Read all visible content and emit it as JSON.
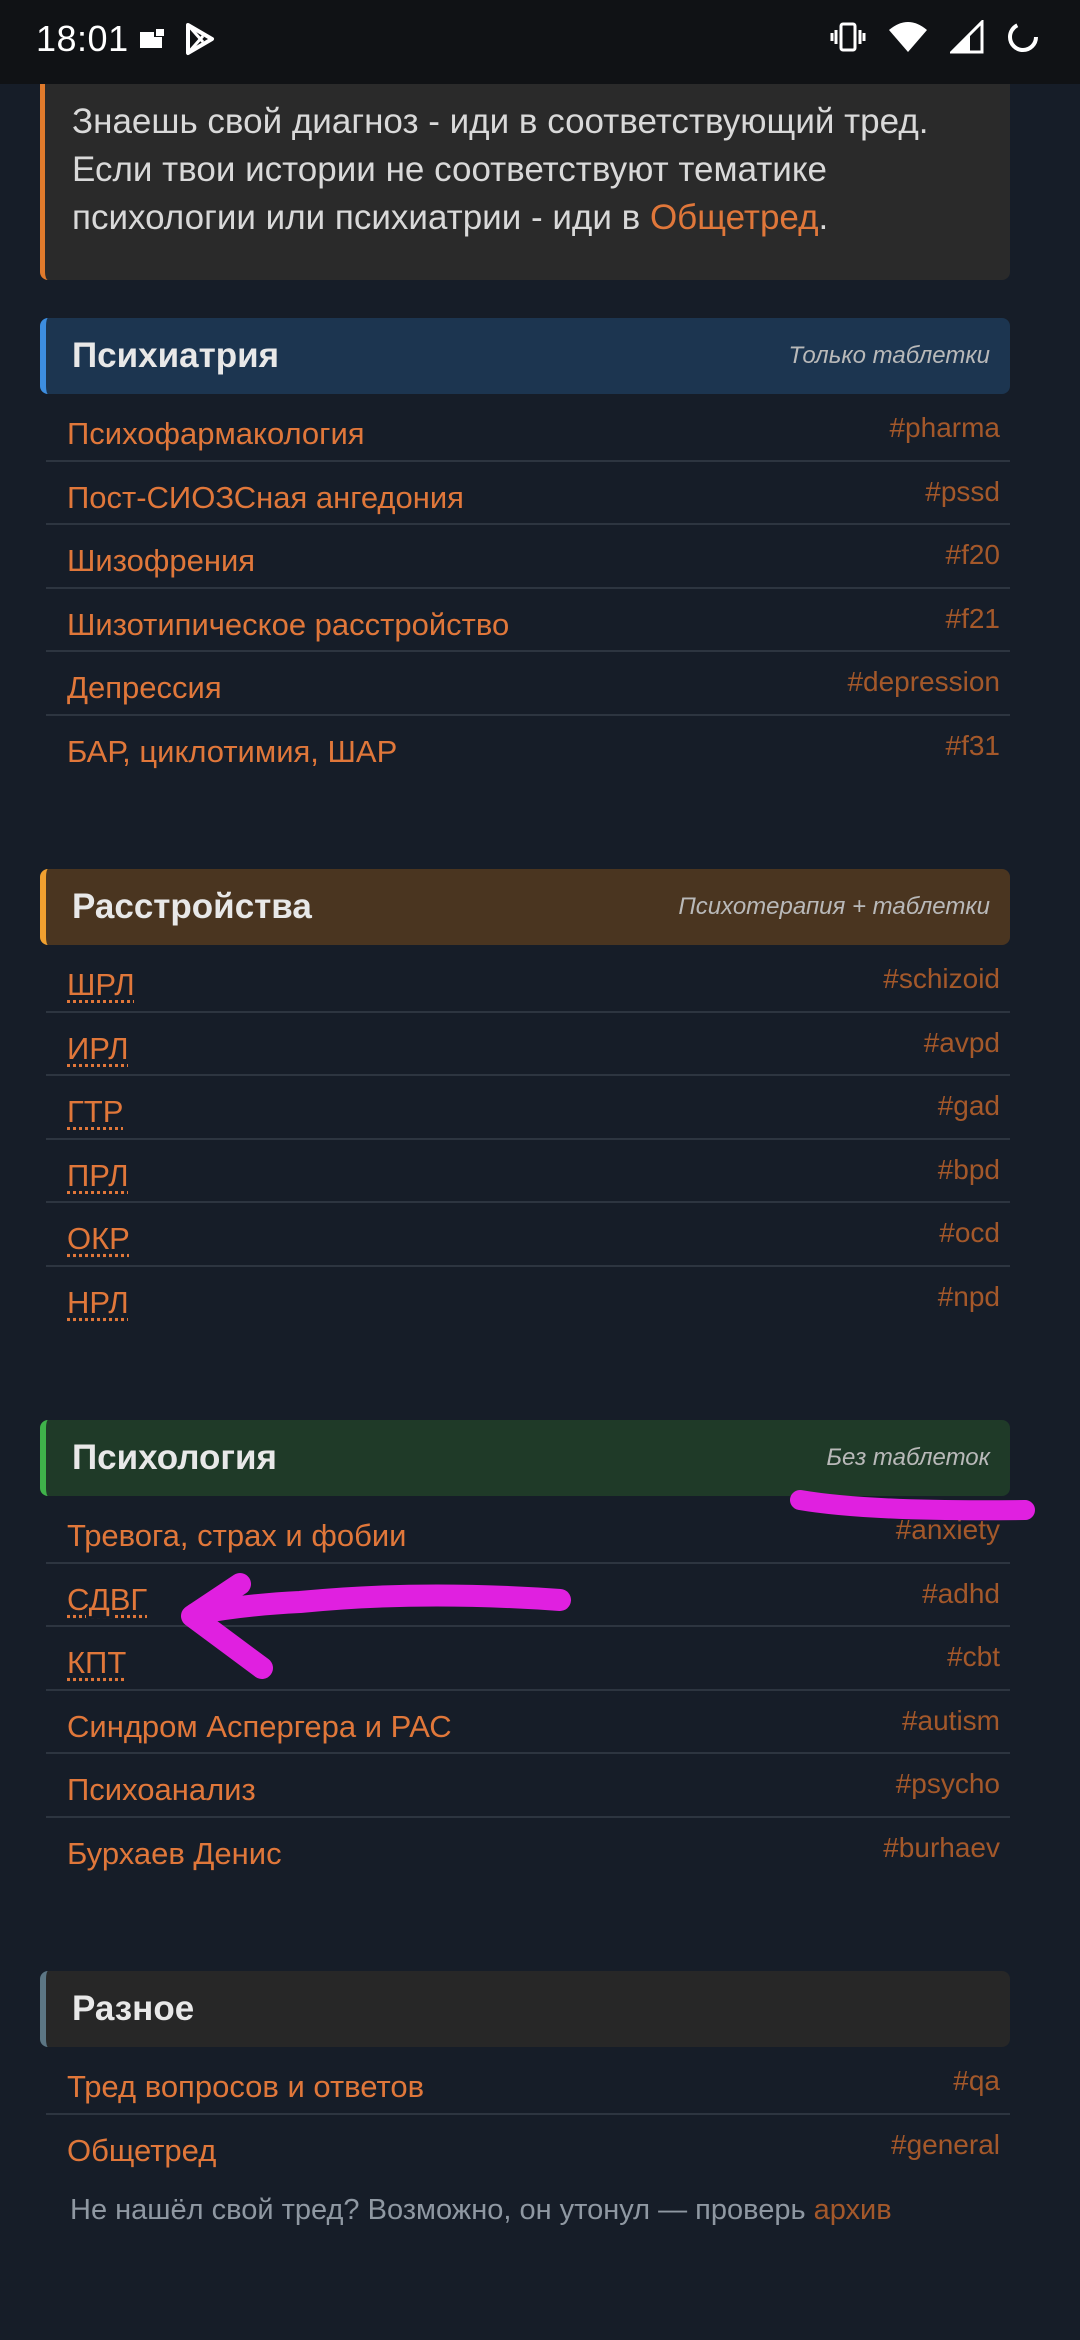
{
  "status_bar": {
    "time": "18:01"
  },
  "notice": {
    "text": "Знаешь свой диагноз - иди в соответствующий тред. Если твои истории не соответствуют тематике психологии или психиатрии - иди в ",
    "link": "Общетред",
    "end": "."
  },
  "sections": {
    "psychiatry": {
      "title": "Психиатрия",
      "subtitle": "Только таблетки",
      "items": [
        {
          "name": "Психофармакология",
          "tag": "#pharma"
        },
        {
          "name": "Пост-СИОЗСная ангедония",
          "tag": "#pssd"
        },
        {
          "name": "Шизофрения",
          "tag": "#f20"
        },
        {
          "name": "Шизотипическое расстройство",
          "tag": "#f21"
        },
        {
          "name": "Депрессия",
          "tag": "#depression"
        },
        {
          "name": "БАР, циклотимия, ШАР",
          "tag": "#f31"
        }
      ]
    },
    "disorders": {
      "title": "Расстройства",
      "subtitle": "Психотерапия + таблетки",
      "items": [
        {
          "name": "ШРЛ",
          "tag": "#schizoid"
        },
        {
          "name": "ИРЛ",
          "tag": "#avpd"
        },
        {
          "name": "ГТР",
          "tag": "#gad"
        },
        {
          "name": "ПРЛ",
          "tag": "#bpd"
        },
        {
          "name": "ОКР",
          "tag": "#ocd"
        },
        {
          "name": "НРЛ",
          "tag": "#npd"
        }
      ]
    },
    "psychology": {
      "title": "Психология",
      "subtitle": "Без таблеток",
      "items": [
        {
          "name": "Тревога, страх и фобии",
          "tag": "#anxiety"
        },
        {
          "name": "СДВГ",
          "tag": "#adhd"
        },
        {
          "name": "КПТ",
          "tag": "#cbt"
        },
        {
          "name": "Синдром Аспергера и РАС",
          "tag": "#autism"
        },
        {
          "name": "Психоанализ",
          "tag": "#psycho"
        },
        {
          "name": "Бурхаев Денис",
          "tag": "#burhaev"
        }
      ]
    },
    "misc": {
      "title": "Разное",
      "items": [
        {
          "name": "Тред вопросов и ответов",
          "tag": "#qa"
        },
        {
          "name": "Общетред",
          "tag": "#general"
        }
      ]
    }
  },
  "footer": {
    "text": "Не нашёл свой тред? Возможно, он утонул — проверь ",
    "link": "архив"
  },
  "colors": {
    "background": "#161d28",
    "link": "#e0773a",
    "annotation": "#e020e0"
  }
}
